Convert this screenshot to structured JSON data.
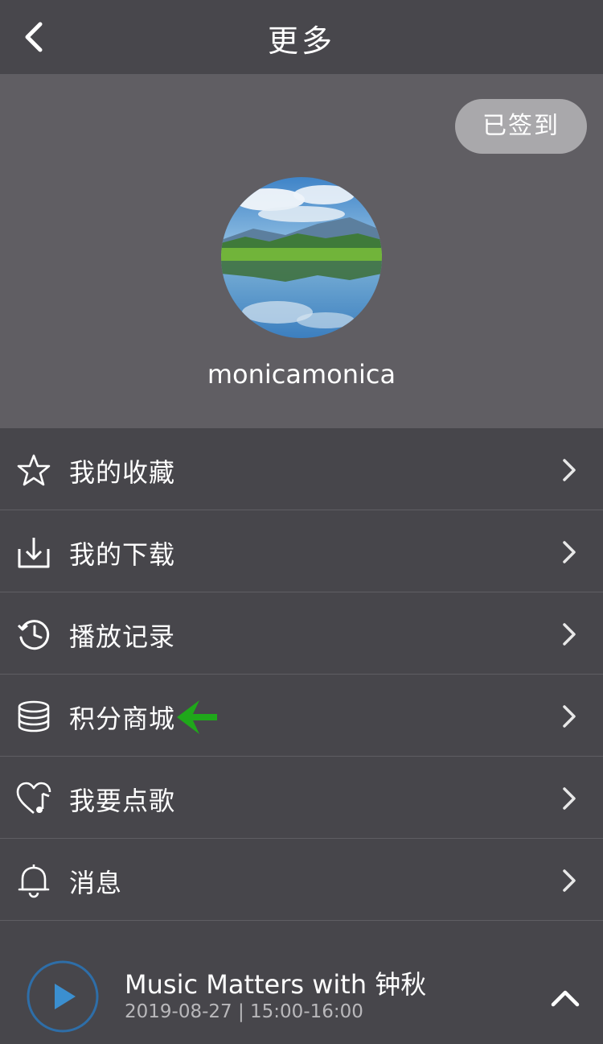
{
  "header": {
    "title": "更多"
  },
  "profile": {
    "checkin_label": "已签到",
    "username": "monicamonica"
  },
  "menu": [
    {
      "label": "我的收藏",
      "icon": "star-icon"
    },
    {
      "label": "我的下载",
      "icon": "download-icon"
    },
    {
      "label": "播放记录",
      "icon": "history-icon"
    },
    {
      "label": "积分商城",
      "icon": "coins-icon"
    },
    {
      "label": "我要点歌",
      "icon": "heart-music-icon"
    },
    {
      "label": "消息",
      "icon": "bell-icon"
    }
  ],
  "player": {
    "title": "Music Matters with 钟秋",
    "time": "2019-08-27 | 15:00-16:00"
  },
  "colors": {
    "background": "#47464b",
    "profile_bg": "#605e63",
    "accent_blue": "#3b8fd0",
    "annotation_green": "#1fa81a"
  }
}
